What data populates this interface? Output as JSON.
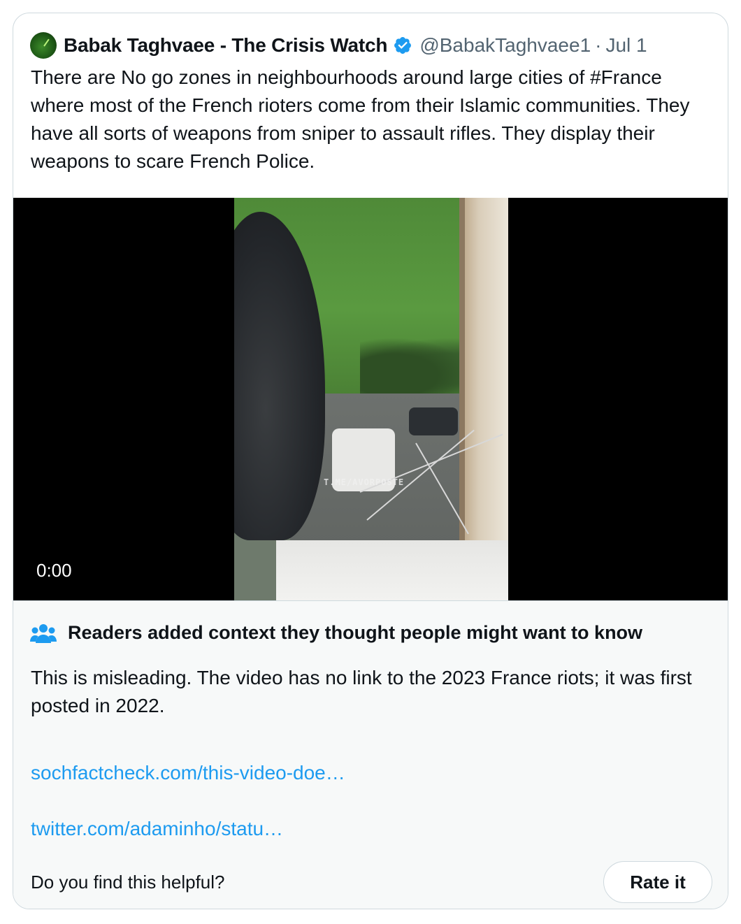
{
  "tweet": {
    "display_name": "Babak Taghvaee - The Crisis Watch",
    "handle": "@BabakTaghvaee1",
    "separator": "·",
    "date": "Jul 1",
    "avatar_icon": "radar-avatar",
    "verified_icon": "verified-badge-icon",
    "verified_color": "#1d9bf0",
    "text": "There are No go zones in neighbourhoods around large cities of #France where most of the French rioters come from their Islamic communities. They have all sorts of weapons from sniper to assault rifles. They display their weapons to scare French Police."
  },
  "video": {
    "timestamp": "0:00",
    "watermark": "T.ME/AVORPOSTE"
  },
  "community_note": {
    "icon": "people-icon",
    "title": "Readers added context they thought people might want to know",
    "body": "This is misleading. The video has no link to the 2023 France riots; it was first posted in 2022.",
    "links": [
      "sochfactcheck.com/this-video-doe…",
      "twitter.com/adaminho/statu…"
    ],
    "link_color": "#1d9bf0",
    "helpful_question": "Do you find this helpful?",
    "rate_button_label": "Rate it"
  }
}
